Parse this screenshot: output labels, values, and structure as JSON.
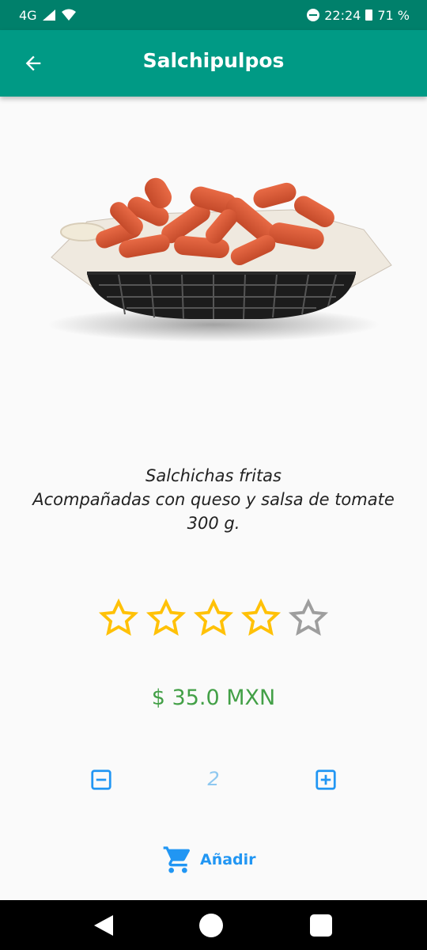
{
  "status_bar": {
    "network": "4G",
    "time": "22:24",
    "battery": "71 %"
  },
  "app_bar": {
    "title": "Salchipulpos",
    "back_icon": "arrow-left-icon"
  },
  "product": {
    "image_icon": "fried-sausages-basket-image",
    "description_line1": "Salchichas fritas",
    "description_line2": "Acompañadas con queso y salsa de tomate",
    "description_line3": "300 g.",
    "rating": 4,
    "rating_max": 5,
    "price": "$ 35.0 MXN",
    "quantity": "2"
  },
  "actions": {
    "add_label": "Añadir",
    "add_icon": "shopping-cart-icon",
    "decrement_icon": "minus-box-icon",
    "increment_icon": "plus-box-icon"
  },
  "colors": {
    "status_bar": "#00806b",
    "app_bar": "#009a85",
    "star_filled": "#ffc107",
    "star_empty": "#9e9e9e",
    "price": "#43a047",
    "accent": "#2196f3"
  }
}
